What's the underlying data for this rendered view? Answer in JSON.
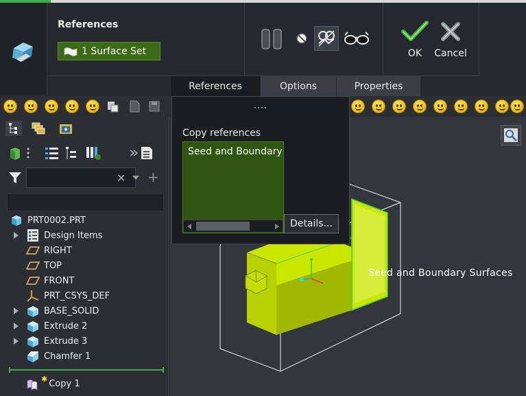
{
  "ribbon": {
    "references_label": "References",
    "surface_set": "1 Surface Set",
    "ok_label": "OK",
    "cancel_label": "Cancel",
    "icons": [
      "copy-feature-icon",
      "pause-icon",
      "no-preview-icon",
      "verify-icon",
      "glasses-icon",
      "checkmark-icon",
      "cross-icon"
    ]
  },
  "tabs": [
    {
      "label": "References",
      "active": true
    },
    {
      "label": "Options",
      "active": false
    },
    {
      "label": "Properties",
      "active": false
    }
  ],
  "dropdown": {
    "title": "Copy references",
    "list_item": "Seed and Boundary",
    "list_item_overflow": "S",
    "details_label": "Details..."
  },
  "tree": {
    "search_placeholder": "",
    "items": [
      {
        "label": "PRT0002.PRT",
        "icon": "part-icon",
        "expandable": false
      },
      {
        "label": "Design Items",
        "icon": "design-items-icon",
        "expandable": true
      },
      {
        "label": "RIGHT",
        "icon": "datum-plane-icon",
        "expandable": false
      },
      {
        "label": "TOP",
        "icon": "datum-plane-icon",
        "expandable": false
      },
      {
        "label": "FRONT",
        "icon": "datum-plane-icon",
        "expandable": false
      },
      {
        "label": "PRT_CSYS_DEF",
        "icon": "csys-icon",
        "expandable": false
      },
      {
        "label": "BASE_SOLID",
        "icon": "extrude-icon",
        "expandable": true
      },
      {
        "label": "Extrude 2",
        "icon": "extrude-icon",
        "expandable": true
      },
      {
        "label": "Extrude 3",
        "icon": "extrude-icon",
        "expandable": true
      },
      {
        "label": "Chamfer 1",
        "icon": "chamfer-icon",
        "expandable": false
      },
      {
        "label": "Copy 1",
        "icon": "copy-feature-icon",
        "expandable": false
      }
    ]
  },
  "graphics": {
    "model_label": "Seed and Boundary Surfaces"
  },
  "colors": {
    "accent_green": "#3fae49",
    "selection_green": "#3c6a16",
    "surface_yellow": "#b5d300",
    "background": "#33363b"
  }
}
